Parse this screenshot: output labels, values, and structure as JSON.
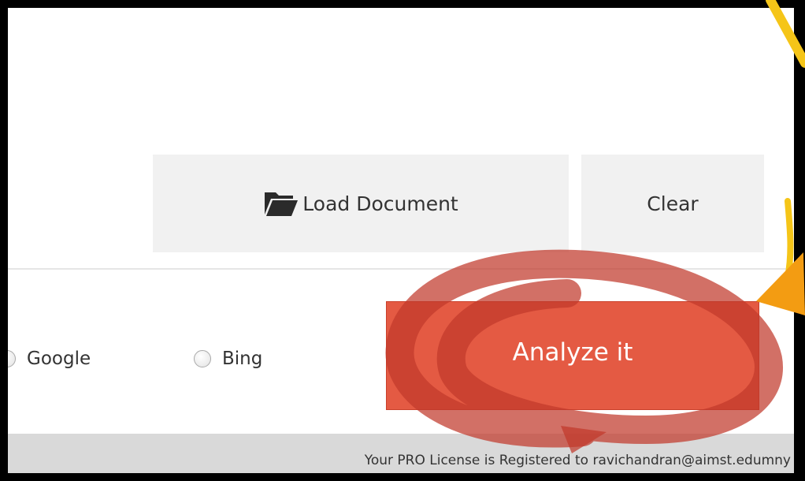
{
  "toolbar": {
    "load_document_label": "Load Document",
    "clear_label": "Clear"
  },
  "search_engines": {
    "options": [
      {
        "label": "Google",
        "selected": false
      },
      {
        "label": "Bing",
        "selected": false
      }
    ]
  },
  "analyze": {
    "label": "Analyze it"
  },
  "footer": {
    "license_text": "Your PRO License is Registered to ravichandran@aimst.edumny"
  },
  "annotations": {
    "circle_color": "#c0392b",
    "arrow_color": "#f5c518"
  },
  "colors": {
    "accent": "#e45a43",
    "button_bg": "#f1f1f1",
    "footer_bg": "#d9d9d9"
  },
  "icons": {
    "load_document": "folder-open-icon"
  }
}
